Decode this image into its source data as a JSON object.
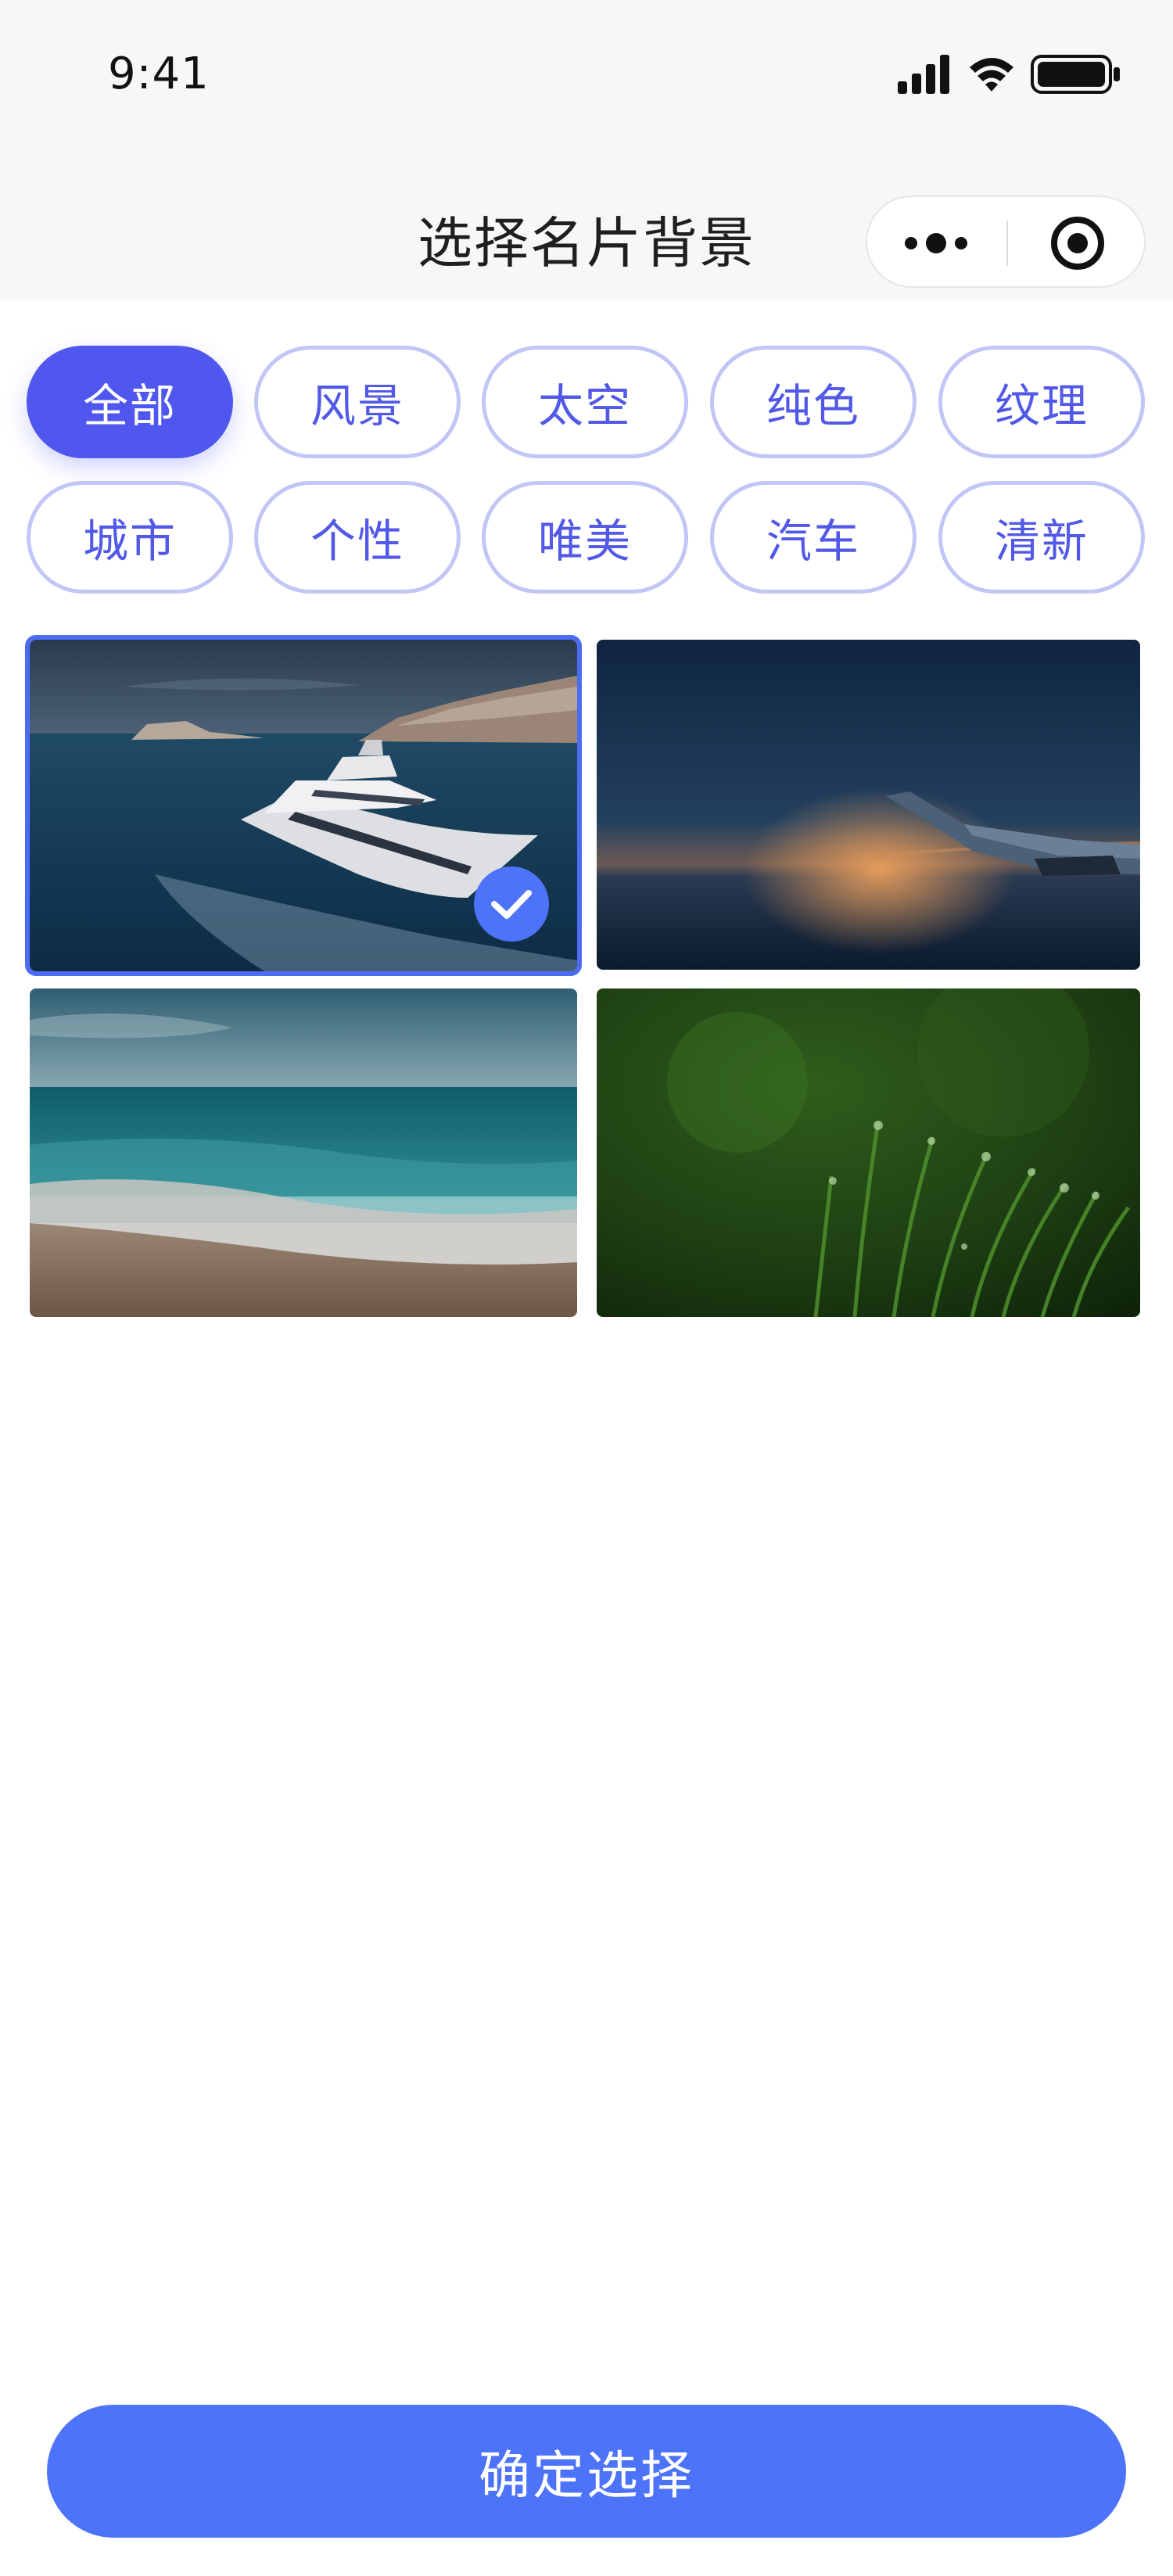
{
  "status_bar": {
    "time": "9:41"
  },
  "nav": {
    "title": "选择名片背景"
  },
  "categories": [
    {
      "label": "全部",
      "active": true
    },
    {
      "label": "风景",
      "active": false
    },
    {
      "label": "太空",
      "active": false
    },
    {
      "label": "纯色",
      "active": false
    },
    {
      "label": "纹理",
      "active": false
    },
    {
      "label": "城市",
      "active": false
    },
    {
      "label": "个性",
      "active": false
    },
    {
      "label": "唯美",
      "active": false
    },
    {
      "label": "汽车",
      "active": false
    },
    {
      "label": "清新",
      "active": false
    }
  ],
  "backgrounds": [
    {
      "name": "yacht-sea",
      "selected": true
    },
    {
      "name": "airplane-wing-sunset",
      "selected": false
    },
    {
      "name": "beach-shore",
      "selected": false
    },
    {
      "name": "green-grass-dew",
      "selected": false
    }
  ],
  "colors": {
    "accent": "#5057ee",
    "confirm": "#4c73f8",
    "chip_border": "#c2c6f6"
  },
  "footer": {
    "confirm_label": "确定选择"
  }
}
